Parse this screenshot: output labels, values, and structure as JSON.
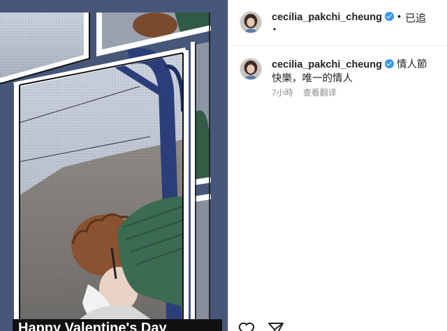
{
  "media": {
    "caption": "Happy Valentine's Day"
  },
  "post": {
    "author": "cecilia_pakchi_cheung",
    "follow_separator": "•",
    "follow_text": "已追",
    "more_separator": "•"
  },
  "comment": {
    "author": "cecilia_pakchi_cheung",
    "text": "情人節快樂，唯一的情人",
    "time": "7小時",
    "translate": "查看翻译"
  },
  "icons": {
    "verified": "verified-badge-icon",
    "like": "heart-icon",
    "share": "paper-plane-icon"
  },
  "colors": {
    "verified_blue": "#3897f0",
    "meta_gray": "#8e8e8e"
  }
}
